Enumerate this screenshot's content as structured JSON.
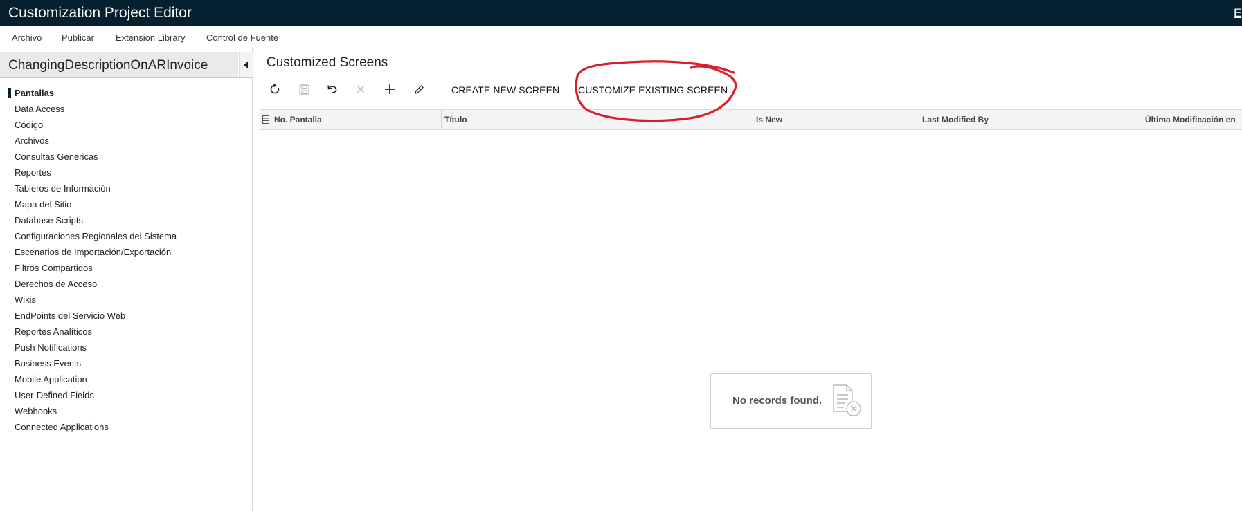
{
  "titlebar": {
    "title": "Customization Project Editor",
    "right_link": "E"
  },
  "menu": {
    "items": [
      "Archivo",
      "Publicar",
      "Extension Library",
      "Control de Fuente"
    ]
  },
  "sidebar": {
    "project_name": "ChangingDescriptionOnARInvoice",
    "active_item": "Pantallas",
    "items": [
      "Pantallas",
      "Data Access",
      "Código",
      "Archivos",
      "Consultas Genericas",
      "Reportes",
      "Tableros de Información",
      "Mapa del Sitio",
      "Database Scripts",
      "Configuraciones Regionales del Sistema",
      "Escenarios de Importación/Exportación",
      "Filtros Compartidos",
      "Derechos de Acceso",
      "Wikis",
      "EndPoints del Servicio Web",
      "Reportes Analíticos",
      "Push Notifications",
      "Business Events",
      "Mobile Application",
      "User-Defined Fields",
      "Webhooks",
      "Connected Applications"
    ]
  },
  "main": {
    "title": "Customized Screens",
    "toolbar": {
      "icons": [
        "refresh-icon",
        "save-icon",
        "undo-icon",
        "delete-icon",
        "add-icon",
        "edit-icon"
      ],
      "create_new_screen": "CREATE NEW SCREEN",
      "customize_existing_screen": "CUSTOMIZE EXISTING SCREEN"
    },
    "grid": {
      "columns": [
        "No. Pantalla",
        "Título",
        "Is New",
        "Last Modified By",
        "Última Modificación en"
      ],
      "empty_message": "No records found."
    }
  },
  "annotation": {
    "color": "#d8202a",
    "shape": "hand-drawn-circle"
  }
}
